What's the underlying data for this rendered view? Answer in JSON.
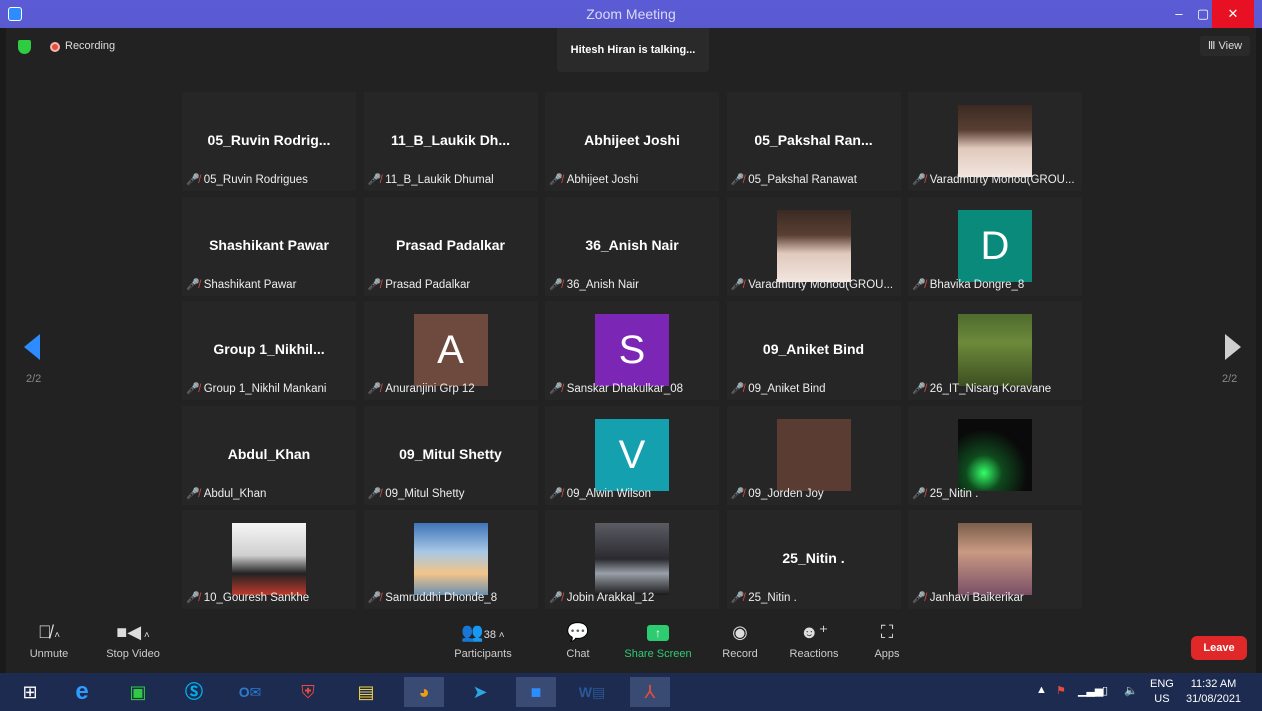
{
  "window": {
    "title": "Zoom Meeting",
    "minimize": "–",
    "maximize": "▢",
    "close": "✕"
  },
  "topbar": {
    "recording": "Recording",
    "talking": "Hitesh Hiran is talking...",
    "view": "Ⅲ View"
  },
  "pager": {
    "left": "2/2",
    "right": "2/2"
  },
  "tiles": [
    {
      "type": "name",
      "big": "05_Ruvin  Rodrig...",
      "label": "05_Ruvin Rodrigues"
    },
    {
      "type": "name",
      "big": "11_B_Laukik  Dh...",
      "label": "11_B_Laukik Dhumal"
    },
    {
      "type": "name",
      "big": "Abhijeet Joshi",
      "label": "Abhijeet Joshi"
    },
    {
      "type": "name",
      "big": "05_Pakshal  Ran...",
      "label": "05_Pakshal Ranawat"
    },
    {
      "type": "photo",
      "label": "Varadmurty Mohod(GROU...",
      "photo": "curly-hair"
    },
    {
      "type": "name",
      "big": "Shashikant Pawar",
      "label": "Shashikant Pawar"
    },
    {
      "type": "name",
      "big": "Prasad Padalkar",
      "label": "Prasad Padalkar"
    },
    {
      "type": "name",
      "big": "36_Anish Nair",
      "label": "36_Anish Nair"
    },
    {
      "type": "photo",
      "label": "Varadmurty Mohod(GROU...",
      "photo": "curly-hair"
    },
    {
      "type": "letter",
      "letter": "D",
      "color": "#0a8a7a",
      "label": "Bhavika Dongre_8"
    },
    {
      "type": "name",
      "big": "Group  1_Nikhil...",
      "label": "Group 1_Nikhil Mankani"
    },
    {
      "type": "letter",
      "letter": "A",
      "color": "#6e4a3e",
      "label": "Anuranjini Grp 12"
    },
    {
      "type": "letter",
      "letter": "S",
      "color": "#7b26b5",
      "label": "Sanskar Dhakulkar_08"
    },
    {
      "type": "name",
      "big": "09_Aniket Bind",
      "label": "09_Aniket Bind"
    },
    {
      "type": "photo",
      "label": "26_IT_Nisarg Koravane",
      "photo": "garden"
    },
    {
      "type": "name",
      "big": "Abdul_Khan",
      "label": "Abdul_Khan"
    },
    {
      "type": "name",
      "big": "09_Mitul Shetty",
      "label": "09_Mitul Shetty"
    },
    {
      "type": "letter",
      "letter": "V",
      "color": "#15a0b0",
      "label": "09_Alwin Wilson"
    },
    {
      "type": "letter",
      "letter": "",
      "color": "#5b3c33",
      "label": "09_Jorden Joy"
    },
    {
      "type": "photo",
      "label": "25_Nitin .",
      "photo": "dark-green"
    },
    {
      "type": "photo",
      "label": "10_Gouresh Sankhe",
      "photo": "anime"
    },
    {
      "type": "photo",
      "label": "Samruddhi Dhonde_8",
      "photo": "sky"
    },
    {
      "type": "photo",
      "label": "Jobin Arakkal_12",
      "photo": "car"
    },
    {
      "type": "name",
      "big": "25_Nitin .",
      "label": "25_Nitin ."
    },
    {
      "type": "photo",
      "label": "Janhavi Baikerikar",
      "photo": "woman"
    }
  ],
  "toolbar": {
    "unmute": "Unmute",
    "stop_video": "Stop Video",
    "participants": "Participants",
    "participants_count": "38",
    "chat": "Chat",
    "share_screen": "Share Screen",
    "record": "Record",
    "reactions": "Reactions",
    "apps": "Apps",
    "leave": "Leave"
  },
  "taskbar": {
    "lang_top": "ENG",
    "lang_bottom": "US",
    "time": "11:32 AM",
    "date": "31/08/2021"
  }
}
